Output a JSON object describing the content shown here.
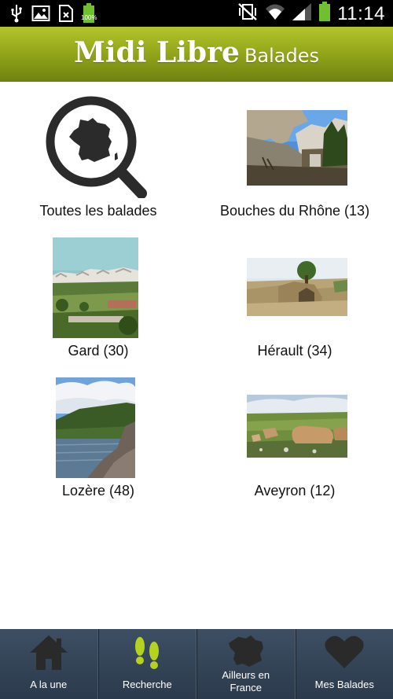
{
  "status_bar": {
    "time": "11:14",
    "battery_text": "100%",
    "left_icons": [
      "usb-icon",
      "image-icon",
      "sim-missing-icon",
      "battery-full-icon"
    ],
    "right_icons": [
      "vibrate-mute-icon",
      "wifi-icon",
      "signal-icon",
      "battery-icon"
    ]
  },
  "header": {
    "brand_main": "Midi Libre",
    "brand_sub": "Balades",
    "background_color": "#95a81a"
  },
  "regions": [
    {
      "label": "Toutes les balades",
      "icon": "search-france-icon"
    },
    {
      "label": "Bouches du Rhône (13)",
      "image": "rocky-cliff-photo"
    },
    {
      "label": "Gard (30)",
      "image": "hill-village-photo"
    },
    {
      "label": "Hérault (34)",
      "image": "stone-tomb-photo"
    },
    {
      "label": "Lozère (48)",
      "image": "lake-rocks-photo"
    },
    {
      "label": "Aveyron (12)",
      "image": "cattle-field-photo"
    }
  ],
  "tabbar": {
    "background_color": "#2f3e51",
    "accent_color": "#b4d21f",
    "tabs": [
      {
        "label": "A la une",
        "icon": "home-icon",
        "active": false
      },
      {
        "label": "Recherche",
        "icon": "footprints-icon",
        "active": true
      },
      {
        "label": "Ailleurs en France",
        "icon": "france-map-icon",
        "active": false
      },
      {
        "label": "Mes Balades",
        "icon": "heart-icon",
        "active": false
      }
    ]
  }
}
